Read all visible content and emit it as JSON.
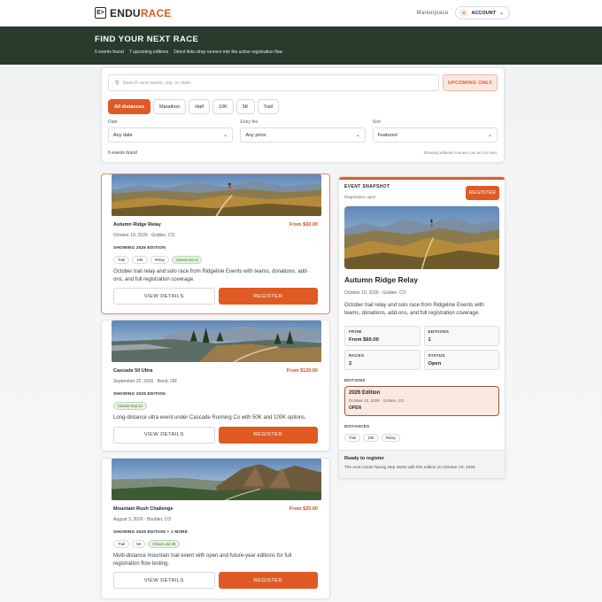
{
  "brand": {
    "mark": "E>",
    "name_part1": "ENDU",
    "name_part2": "RACE"
  },
  "nav": {
    "marketplace": "Marketplace",
    "account_label": "ACCOUNT",
    "account_icon": "user-icon"
  },
  "hero": {
    "title": "FIND YOUR NEXT RACE",
    "events_found": "6 events found",
    "upcoming_editions": "7 upcoming editions",
    "note": "Direct links drop runners into the active registration flow"
  },
  "filters": {
    "search_placeholder": "Search race name, city, or state",
    "upcoming_only": "UPCOMING ONLY",
    "distance_chips": [
      "All distances",
      "Marathon",
      "Half",
      "10K",
      "5K",
      "Trail"
    ],
    "active_chip": "All distances",
    "date": {
      "label": "Date",
      "value": "Any date"
    },
    "fee": {
      "label": "Entry fee",
      "value": "Any price"
    },
    "sort": {
      "label": "Sort",
      "value": "Featured"
    },
    "found": "6 events found",
    "editions_note": "Showing editions runners can act on next."
  },
  "cards": [
    {
      "title": "Autumn Ridge Relay",
      "price": "From $60.00",
      "meta": "October 10, 2026 · Golden, CO",
      "edition": "SHOWING 2026 EDITION",
      "tags": [
        "Trail",
        "10K",
        "Relay"
      ],
      "status_tag": "Closes Oct 9",
      "description": "October trail relay and solo race from Ridgeline Events with teams, donations, add-ons, and full registration coverage.",
      "view_label": "VIEW DETAILS",
      "register_label": "REGISTER"
    },
    {
      "title": "Cascade 50 Ultra",
      "price": "From $120.00",
      "meta": "September 22, 2026 · Bend, OR",
      "edition": "SHOWING 2026 EDITION",
      "tags": [],
      "status_tag": "Closes Sep 12",
      "description": "Long-distance ultra event under Cascade Running Co with 50K and 100K options.",
      "view_label": "VIEW DETAILS",
      "register_label": "REGISTER"
    },
    {
      "title": "Mountain Rush Challenge",
      "price": "From $25.00",
      "meta": "August 3, 2026 · Boulder, CO",
      "edition": "SHOWING 2026 EDITION + 1 MORE",
      "tags": [
        "Trail",
        "5K"
      ],
      "status_tag": "Closes Jul 29",
      "description": "Multi-distance mountain trail event with open and future-year editions for full registration flow testing.",
      "view_label": "VIEW DETAILS",
      "register_label": "REGISTER"
    }
  ],
  "snapshot": {
    "label": "EVENT SNAPSHOT",
    "sub": "Registration open",
    "register_label": "REGISTER",
    "title": "Autumn Ridge Relay",
    "meta": "October 10, 2026 · Golden, CO",
    "description": "October trail relay and solo race from Ridgeline Events with teams, donations, add-ons, and full registration coverage.",
    "stats": [
      {
        "key": "FROM",
        "value": "From $60.00"
      },
      {
        "key": "EDITIONS",
        "value": "1"
      },
      {
        "key": "RACES",
        "value": "2"
      },
      {
        "key": "STATUS",
        "value": "Open"
      }
    ],
    "editions_label": "EDITIONS",
    "edition": {
      "title": "2026 Edition",
      "meta": "October 10, 2026 · Golden, CO",
      "status": "OPEN"
    },
    "distances_label": "DISTANCES",
    "distances": [
      "Trail",
      "10K",
      "Relay"
    ],
    "footer_title": "Ready to register",
    "footer_text": "The next runner-facing step starts with this edition on October 10, 2026."
  },
  "colors": {
    "accent": "#e05a24",
    "hero_bg": "#273a2c",
    "brand_dark": "#1e2a20"
  }
}
